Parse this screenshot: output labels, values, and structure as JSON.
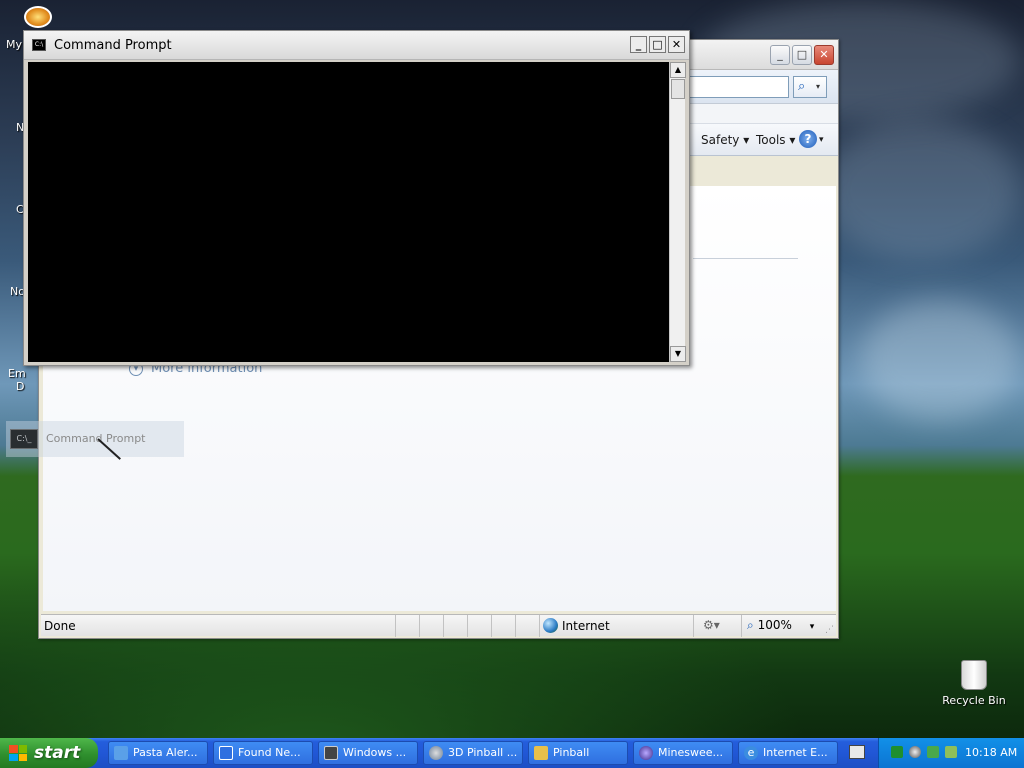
{
  "desktop": {
    "left_labels": [
      "My",
      "N",
      "C",
      "No",
      "Em",
      "D"
    ],
    "recycle_bin": "Recycle Bin"
  },
  "ie_window": {
    "commands": {
      "safety": "Safety ▾",
      "tools": "Tools ▾",
      "help_arrow": "▾"
    },
    "more_info": "More information",
    "status": {
      "text": "Done",
      "zone": "Internet",
      "zoom": "100%",
      "zoom_arrow": "▾"
    },
    "caption": {
      "minimize": "_",
      "maximize": "□",
      "close": "✕"
    }
  },
  "cmd_window": {
    "title": "Command Prompt",
    "icon_text": "C:\\",
    "caption": {
      "minimize": "_",
      "maximize": "□",
      "close": "✕"
    }
  },
  "drag_ghost": {
    "label": "Command Prompt",
    "icon_text": "C:\\_"
  },
  "taskbar": {
    "start_label": "start",
    "tasks": [
      {
        "label": "Pasta Aler...",
        "icon_color": "#5aa0e8"
      },
      {
        "label": "Found Ne...",
        "icon_color": "#2f6fe0"
      },
      {
        "label": "Windows ...",
        "icon_color": "#444444"
      },
      {
        "label": "3D Pinball ...",
        "icon_color": "#8aa3c0"
      },
      {
        "label": "Pinball",
        "icon_color": "#e8c04a"
      },
      {
        "label": "Mineswee...",
        "icon_color": "#6a5acd"
      },
      {
        "label": "Internet E...",
        "icon_color": "#3b8de0"
      }
    ],
    "clock": "10:18 AM"
  },
  "colors": {
    "taskbar_blue": "#245edc",
    "start_green": "#2f8f2e",
    "tray_blue": "#0c74d2",
    "console_black": "#000000"
  }
}
